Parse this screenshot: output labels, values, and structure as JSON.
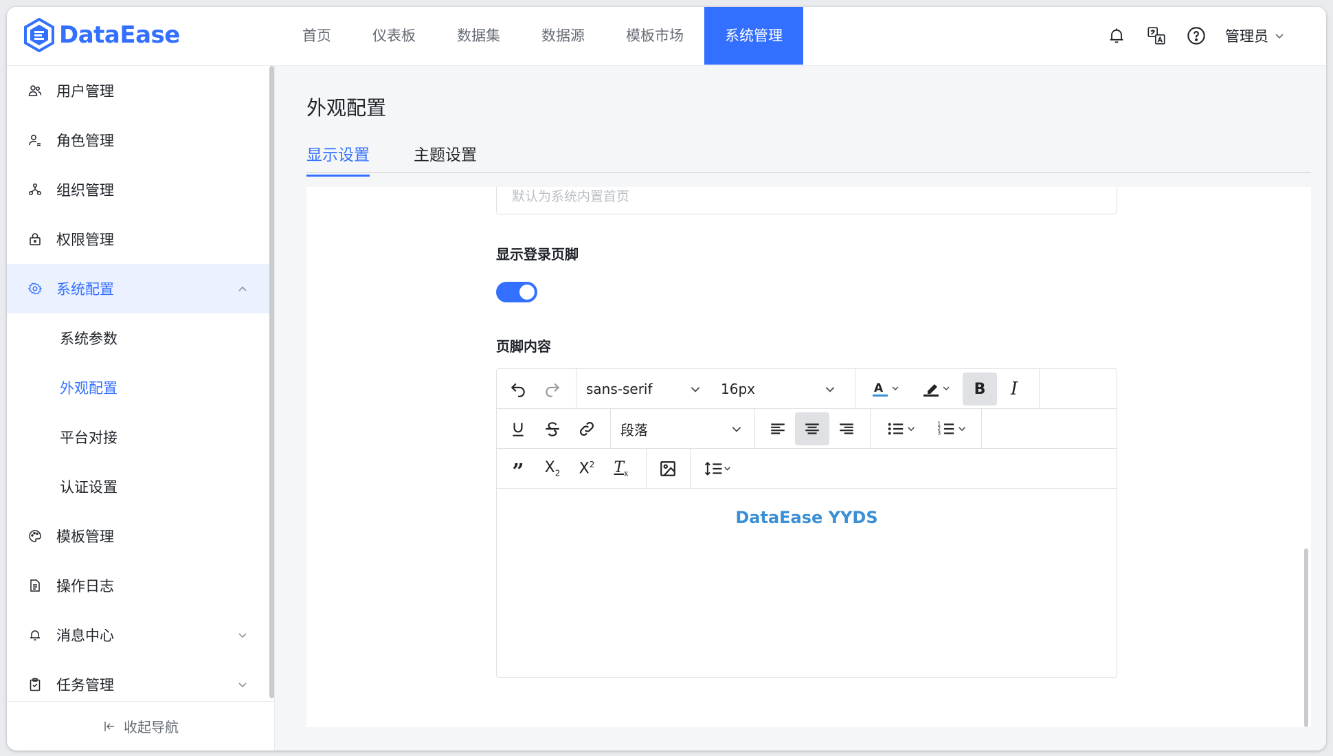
{
  "brand": {
    "name": "DataEase",
    "color": "#3370ff"
  },
  "nav": {
    "items": [
      "首页",
      "仪表板",
      "数据集",
      "数据源",
      "模板市场",
      "系统管理"
    ],
    "active_index": 5
  },
  "header_right": {
    "icons": [
      "bell-icon",
      "translate-icon",
      "help-icon"
    ],
    "user": "管理员"
  },
  "sidebar": {
    "items": [
      {
        "label": "用户管理",
        "icon": "users-icon"
      },
      {
        "label": "角色管理",
        "icon": "role-icon"
      },
      {
        "label": "组织管理",
        "icon": "org-icon"
      },
      {
        "label": "权限管理",
        "icon": "lock-icon"
      },
      {
        "label": "系统配置",
        "icon": "gear-icon",
        "expanded": true
      },
      {
        "label": "模板管理",
        "icon": "palette-icon"
      },
      {
        "label": "操作日志",
        "icon": "document-icon"
      },
      {
        "label": "消息中心",
        "icon": "bell-icon"
      },
      {
        "label": "任务管理",
        "icon": "clipboard-icon"
      }
    ],
    "sub_items": [
      "系统参数",
      "外观配置",
      "平台对接",
      "认证设置"
    ],
    "active_sub": "外观配置",
    "collapse_label": "收起导航"
  },
  "page": {
    "title": "外观配置",
    "tabs": [
      "显示设置",
      "主题设置"
    ],
    "active_tab": "显示设置"
  },
  "form": {
    "homepage_placeholder": "默认为系统内置首页",
    "show_footer_label": "显示登录页脚",
    "show_footer_enabled": true,
    "footer_content_label": "页脚内容"
  },
  "editor": {
    "font_family": "sans-serif",
    "font_size": "16px",
    "block_type": "段落",
    "content": "DataEase YYDS",
    "content_color": "#3a8fd6"
  }
}
